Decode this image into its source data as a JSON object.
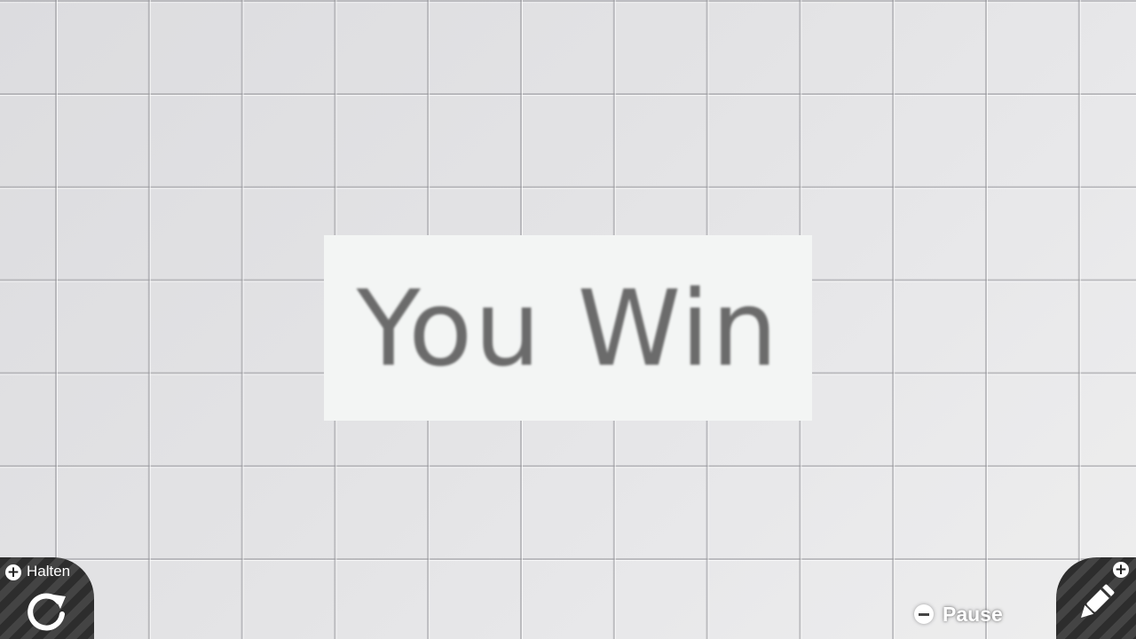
{
  "result": {
    "text": "You Win"
  },
  "controls": {
    "hold": {
      "button_glyph": "+",
      "label": "Halten",
      "icon": "rotate-icon"
    },
    "edit": {
      "button_glyph": "+",
      "icon": "pencil-icon"
    },
    "pause": {
      "button_glyph": "minus",
      "label": "Pause"
    }
  },
  "colors": {
    "background": "#e4e4e6",
    "panel": "#f3f5f4",
    "result_text": "#6b6b6b",
    "corner_stripes": "#2d2d2d"
  }
}
